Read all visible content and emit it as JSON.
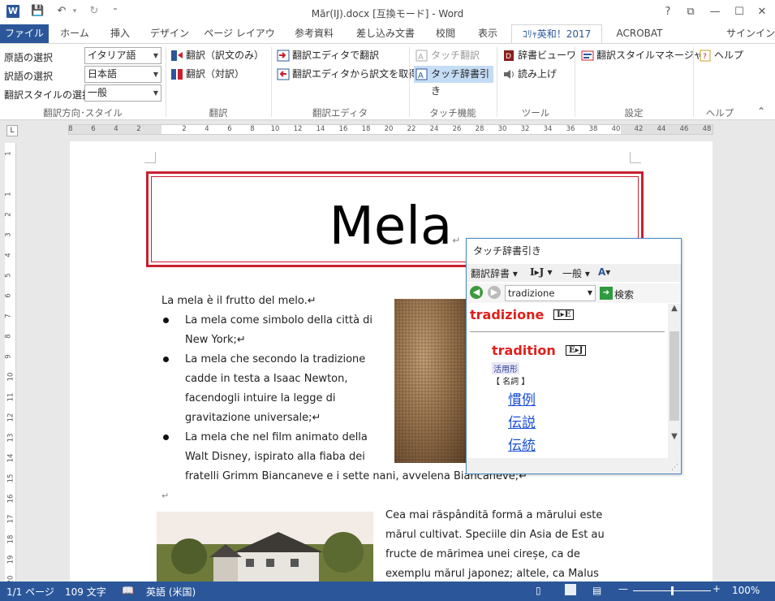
{
  "window": {
    "title": "Măr(IJ).docx [互換モード] - Word",
    "help": "?",
    "min": "—",
    "max": "☐",
    "close": "✕",
    "restore": "⧉"
  },
  "quick_access": {
    "word_logo": "W",
    "save": "💾",
    "undo": "↶",
    "undo_more": "▾",
    "redo": "↻",
    "customize": "⁼"
  },
  "tabs": [
    "ファイル",
    "ホーム",
    "挿入",
    "デザイン",
    "ページ レイアウト",
    "参考資料",
    "差し込み文書",
    "校閲",
    "表示",
    "ｺﾘｬ英和！2017",
    "ACROBAT"
  ],
  "signin": "サインイン",
  "ribbon": {
    "groups": [
      "翻訳方向･スタイル",
      "翻訳",
      "翻訳エディタ",
      "タッチ機能",
      "ツール",
      "設定",
      "ヘルプ"
    ],
    "src_lang_label": "原語の選択",
    "src_lang_value": "イタリア語",
    "dst_lang_label": "訳語の選択",
    "dst_lang_value": "日本語",
    "style_label": "翻訳スタイルの選択",
    "style_value": "一般",
    "translate_only": "翻訳（訳文のみ）",
    "translate_pair": "翻訳（対訳）",
    "editor_translate": "翻訳エディタで翻訳",
    "editor_fetch": "翻訳エディタから訳文を取得",
    "touch_translate": "タッチ翻訳",
    "touch_dict": "タッチ辞書引き",
    "dict_viewer": "辞書ビューワ",
    "read_aloud": "読み上げ",
    "style_manager": "翻訳スタイルマネージャ",
    "help": "ヘルプ",
    "collapse": "⌃"
  },
  "ruler": {
    "h": [
      "8",
      "6",
      "4",
      "2",
      "",
      "2",
      "4",
      "6",
      "8",
      "10",
      "12",
      "14",
      "16",
      "18",
      "20",
      "22",
      "24",
      "26",
      "28",
      "30",
      "32",
      "34",
      "36",
      "38",
      "40",
      "42",
      "44",
      "46",
      "48"
    ],
    "v": [
      "1",
      "",
      "1",
      "2",
      "3",
      "4",
      "5",
      "6",
      "7",
      "8",
      "9",
      "10",
      "11",
      "12",
      "13",
      "14",
      "15",
      "16",
      "17",
      "18",
      "19",
      "20"
    ],
    "corner": "L"
  },
  "doc": {
    "title": "Mela",
    "title_mark": "↵",
    "intro": "La mela è il frutto del melo.↵",
    "bullets": [
      [
        "La mela come simbolo della città di",
        "New York;↵"
      ],
      [
        "La mela che secondo la tradizione",
        "cadde in testa a Isaac Newton,",
        "facendogli intuire la legge di",
        "gravitazione universale;↵"
      ],
      [
        "La mela che nel film animato della",
        "Walt Disney, ispirato alla fiaba dei",
        "fratelli Grimm Biancaneve e i sette nani, avvelena Biancaneve;↵"
      ]
    ],
    "empty_para": "↵",
    "romanian": [
      "Cea mai răspândită formă a mărului este",
      "mărul cultivat. Speciile din Asia de Est au",
      "fructe de mărimea unei cireșe, ca de",
      "exemplu mărul japonez; altele, ca Malus"
    ]
  },
  "popup": {
    "title": "タッチ辞書引き",
    "dict_menu": "翻訳辞書 ▾",
    "dir_menu": "I▸J ▾",
    "style_menu": "一般 ▾",
    "tools_menu": "▾",
    "search_value": "tradizione",
    "search_btn": "検索",
    "headword": "tradizione",
    "headword_tag": "I▸E",
    "english": "tradition",
    "english_tag": "E▸J",
    "inflection": "活用形",
    "pos": "【 名詞 】",
    "meanings": [
      "慣例",
      "伝説",
      "伝統"
    ]
  },
  "status": {
    "page": "1/1 ページ",
    "words": "109 文字",
    "lang": "英語 (米国)",
    "zoom": "100%",
    "zoom_minus": "—",
    "zoom_plus": "+",
    "zoom_level": 0.5
  },
  "colors": {
    "accent": "#2b579a",
    "title_red": "#c8202f",
    "dict_red": "#e0201c",
    "link_blue": "#1a4fd6"
  }
}
